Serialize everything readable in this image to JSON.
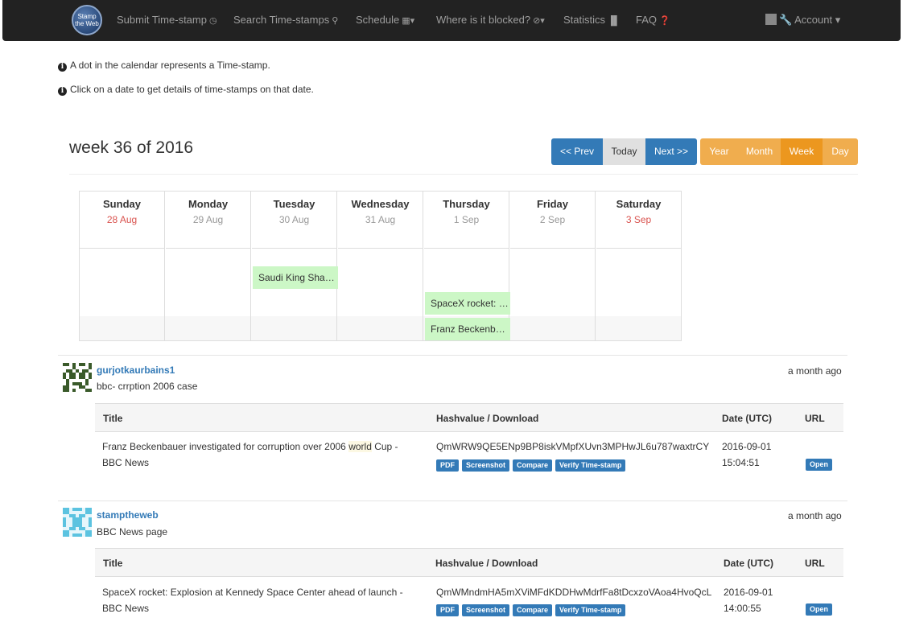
{
  "nav": {
    "brand": "Stamp the Web",
    "items": [
      {
        "label": "Submit Time-stamp",
        "icon": "clock-icon",
        "glyph": "◷"
      },
      {
        "label": "Search Time-stamps",
        "icon": "search-icon",
        "glyph": "⚲"
      },
      {
        "label": "Schedule",
        "icon": "calendar-icon",
        "glyph": "▦▾"
      },
      {
        "label": "Where is it blocked?",
        "icon": "ban-icon",
        "glyph": "⊘▾"
      },
      {
        "label": "Statistics",
        "icon": "bar-chart-icon",
        "glyph": "▐▌"
      },
      {
        "label": "FAQ",
        "icon": "question-icon",
        "glyph": "❓"
      }
    ],
    "account": "Account"
  },
  "info": [
    "A dot in the calendar represents a Time-stamp.",
    "Click on a date to get details of time-stamps on that date."
  ],
  "calendar": {
    "title": "week 36 of 2016",
    "nav_buttons": {
      "prev": "<< Prev",
      "today": "Today",
      "next": "Next >>"
    },
    "views": [
      "Year",
      "Month",
      "Week",
      "Day"
    ],
    "active_view": "Week",
    "days": [
      {
        "name": "Sunday",
        "date": "28 Aug",
        "weekend": true
      },
      {
        "name": "Monday",
        "date": "29 Aug",
        "weekend": false
      },
      {
        "name": "Tuesday",
        "date": "30 Aug",
        "weekend": false
      },
      {
        "name": "Wednesday",
        "date": "31 Aug",
        "weekend": false
      },
      {
        "name": "Thursday",
        "date": "1 Sep",
        "weekend": false
      },
      {
        "name": "Friday",
        "date": "2 Sep",
        "weekend": false
      },
      {
        "name": "Saturday",
        "date": "3 Sep",
        "weekend": true
      }
    ],
    "events": [
      {
        "label": "Saudi King Sha…",
        "day": "Tuesday"
      },
      {
        "label": "SpaceX rocket: …",
        "day": "Thursday"
      },
      {
        "label": "Franz Beckenb…",
        "day": "Thursday"
      }
    ]
  },
  "entries": [
    {
      "user": "gurjotkaurbains1",
      "description": "bbc- crrption 2006 case",
      "time_ago": "a month ago",
      "headers": {
        "title": "Title",
        "hash": "Hashvalue / Download",
        "date": "Date (UTC)",
        "url": "URL"
      },
      "title_parts": [
        "Franz Beckenbauer investigated for corruption over 2006 ",
        "world",
        " Cup -",
        "BBC News"
      ],
      "hash": "QmWRW9QE5ENp9BP8iskVMpfXUvn3MPHwJL6u787waxtrCY",
      "buttons": [
        "PDF",
        "Screenshot",
        "Compare",
        "Verify Time-stamp"
      ],
      "date": "2016-09-01",
      "time": "15:04:51",
      "open": "Open"
    },
    {
      "user": "stamptheweb",
      "description": "BBC News page",
      "time_ago": "a month ago",
      "headers": {
        "title": "Title",
        "hash": "Hashvalue / Download",
        "date": "Date (UTC)",
        "url": "URL"
      },
      "title_parts": [
        "SpaceX rocket: Explosion at Kennedy Space Center ahead of launch -",
        "",
        "",
        "BBC News"
      ],
      "hash": "QmWMndmHA5mXViMFdKDDHwMdrfFa8tDcxzoVAoa4HvoQcL",
      "buttons": [
        "PDF",
        "Screenshot",
        "Compare",
        "Verify Time-stamp"
      ],
      "date": "2016-09-01",
      "time": "14:00:55",
      "open": "Open"
    }
  ]
}
